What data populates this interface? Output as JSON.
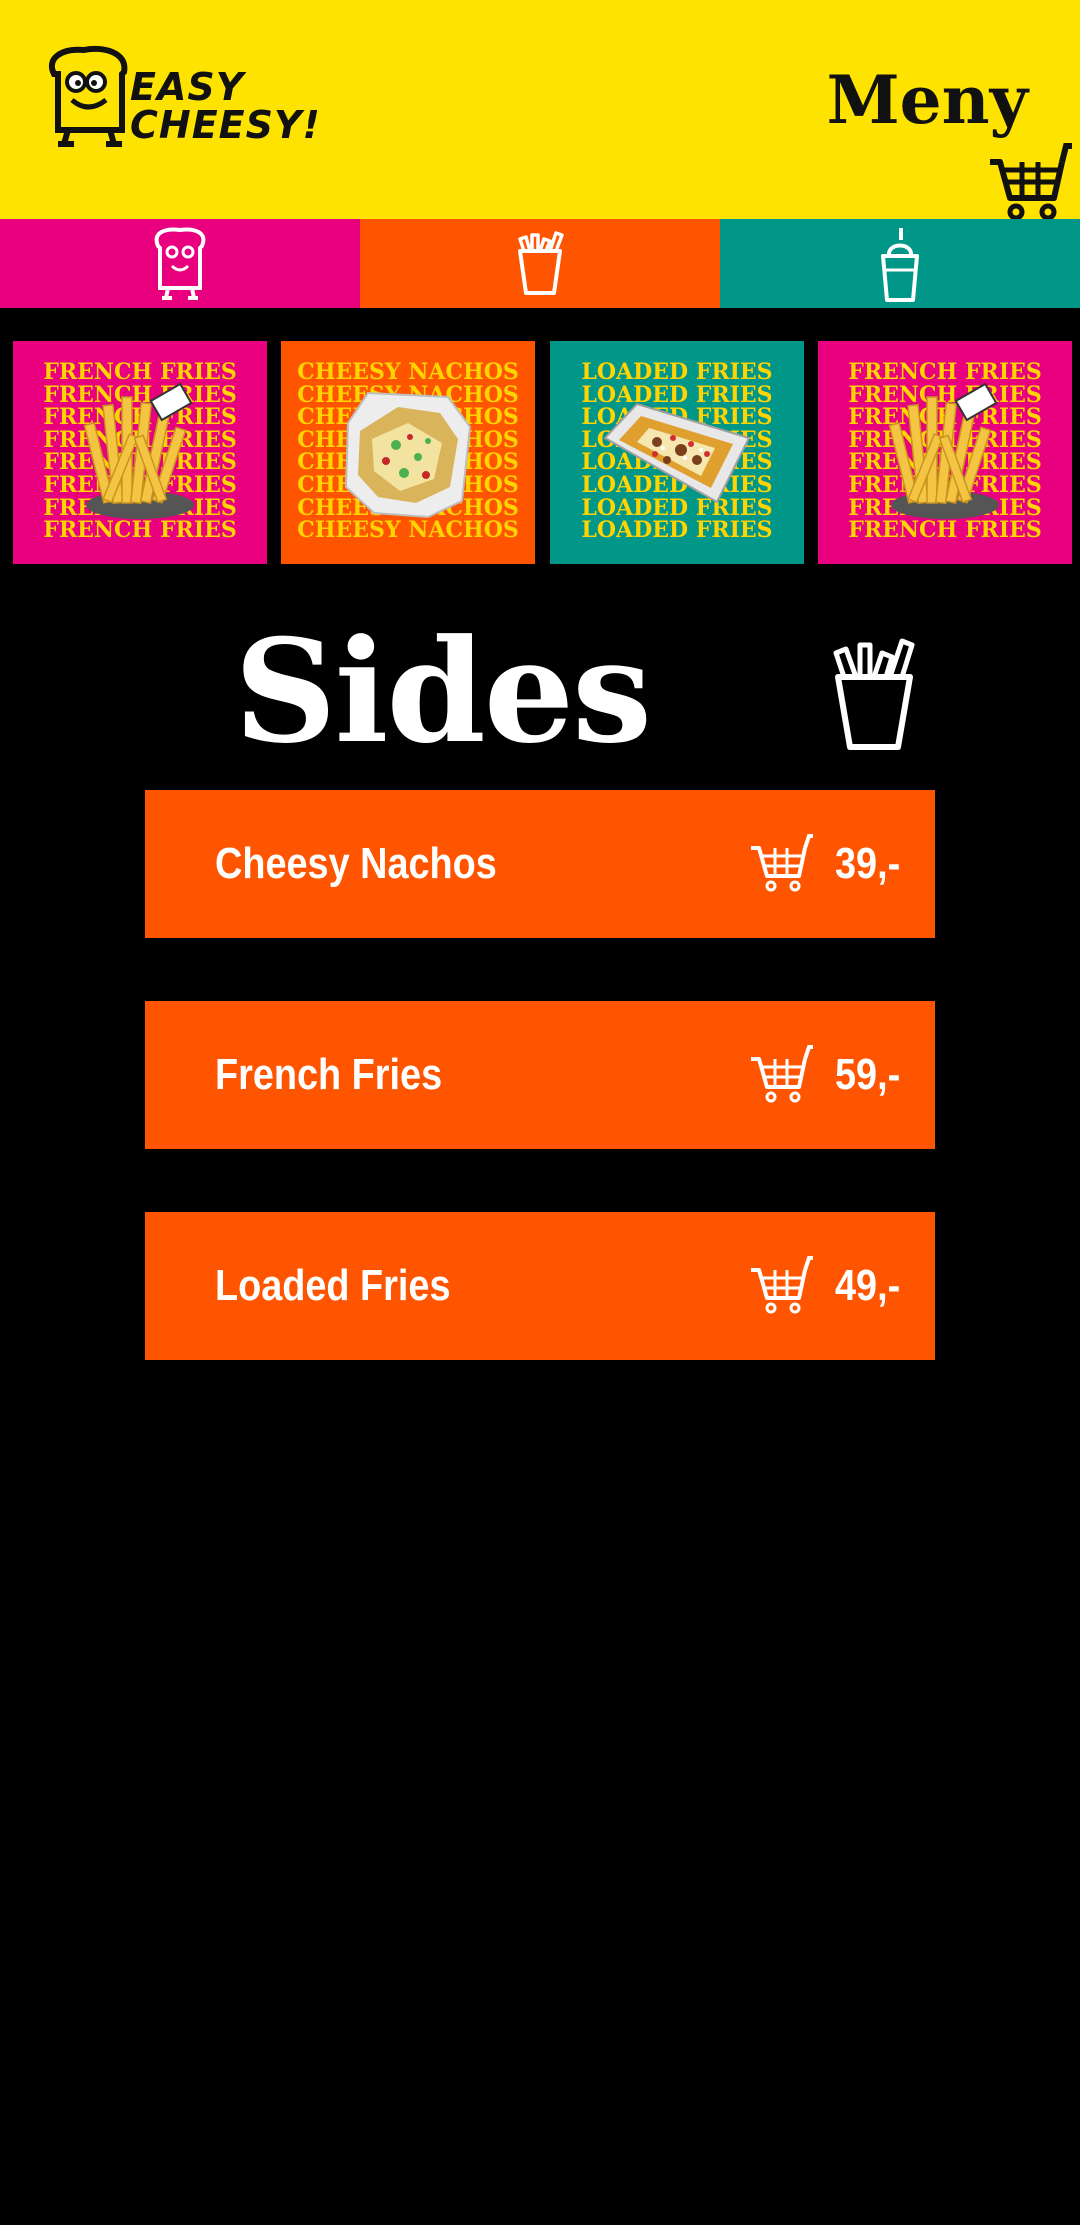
{
  "brand": {
    "logo_line1": "EASY",
    "logo_line2": "CHEESY!"
  },
  "header": {
    "title": "Meny"
  },
  "tabs": [
    {
      "name": "toast",
      "icon": "toast-icon",
      "color": "#E8007E"
    },
    {
      "name": "sides",
      "icon": "fries-icon",
      "color": "#FF5500",
      "selected": true
    },
    {
      "name": "drinks",
      "icon": "milkshake-icon",
      "color": "#009688"
    }
  ],
  "carousel": [
    {
      "text": "FRENCH FRIES",
      "bg": "#E8007E",
      "text_color": "#FFD400"
    },
    {
      "text": "CHEESY NACHOS",
      "bg": "#FF5500",
      "text_color": "#FFD400"
    },
    {
      "text": "LOADED FRIES",
      "bg": "#009688",
      "text_color": "#FFD400"
    },
    {
      "text": "FRENCH FRIES",
      "bg": "#E8007E",
      "text_color": "#FFD400"
    }
  ],
  "section": {
    "title": "Sides",
    "icon": "fries-icon"
  },
  "items": [
    {
      "name": "Cheesy Nachos",
      "price": "39,-"
    },
    {
      "name": "French Fries",
      "price": "59,-"
    },
    {
      "name": "Loaded Fries",
      "price": "49,-"
    }
  ],
  "colors": {
    "header_bg": "#FFE300",
    "page_bg": "#000000",
    "item_bg": "#FF5500",
    "text_light": "#FFFFFF"
  }
}
